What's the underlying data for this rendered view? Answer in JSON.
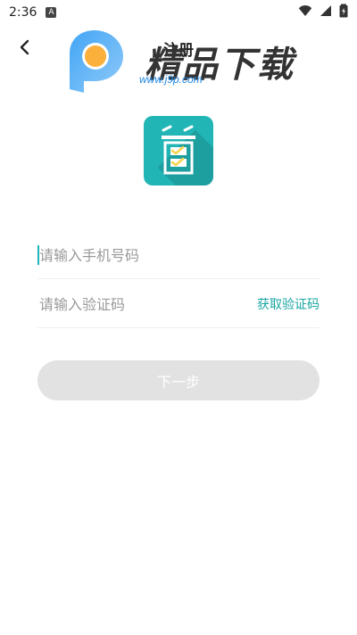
{
  "status": {
    "time": "2:36",
    "notif_badge": "A"
  },
  "header": {
    "title": "注册"
  },
  "watermark": {
    "brand_text": "精品下载",
    "url": "www.j9p.com"
  },
  "form": {
    "phone_placeholder": "请输入手机号码",
    "code_placeholder": "请输入验证码",
    "get_code_label": "获取验证码"
  },
  "actions": {
    "next_label": "下一步"
  },
  "colors": {
    "accent": "#22b5b6",
    "accent_text": "#1aa6a3",
    "button_disabled": "#e2e2e2"
  },
  "icons": [
    "back-arrow-icon",
    "wifi-icon",
    "signal-icon",
    "battery-icon",
    "app-logo-icon",
    "watermark-logo-icon"
  ]
}
